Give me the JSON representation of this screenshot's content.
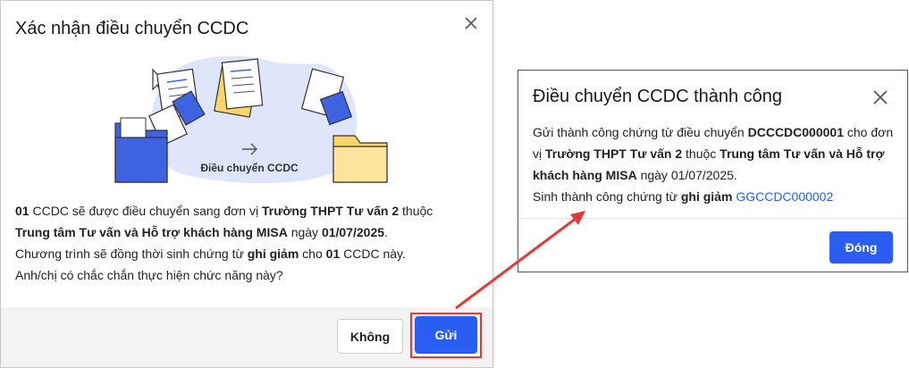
{
  "dialog_confirm": {
    "title": "Xác nhận điều chuyển CCDC",
    "illustration_caption": "Điều chuyển CCDC",
    "line1": {
      "count": "01",
      "t1": " CCDC sẽ được điều chuyển sang đơn vị ",
      "unit": "Trường THPT Tư vấn 2",
      "t2": " thuộc ",
      "parent": "Trung tâm Tư vấn và Hỗ trợ khách hàng MISA",
      "t3": " ngày ",
      "date": "01/07/2025",
      "t4": "."
    },
    "line2": {
      "t1": "Chương trình sẽ đồng thời sinh chứng từ ",
      "voucher_type": "ghi giảm",
      "t2": " cho ",
      "count": "01",
      "t3": " CCDC này."
    },
    "line3": "Anh/chị có chắc chắn thực hiện chức năng này?",
    "cancel_label": "Không",
    "send_label": "Gửi"
  },
  "dialog_success": {
    "title": "Điều chuyển CCDC thành công",
    "line1": {
      "t1": "Gửi thành công chứng từ điều chuyển ",
      "code": "DCCCDC000001",
      "t2": " cho đơn vị ",
      "unit": "Trường THPT Tư vấn 2",
      "t3": " thuộc ",
      "parent": "Trung tâm Tư vấn và Hỗ trợ khách hàng MISA",
      "t4": " ngày 01/07/2025."
    },
    "line2": {
      "t1": "Sinh thành công chứng từ ",
      "voucher_type": "ghi giảm",
      "t2": " ",
      "code": "GGCCDC000002"
    },
    "ok_label": "Đóng"
  },
  "colors": {
    "primary": "#2a5ef2",
    "highlight": "#e53935",
    "footer_bg": "#f3f3f3",
    "folder_blue": "#3d63e0",
    "folder_yellow": "#fcd56a"
  },
  "icons": [
    "close-icon",
    "cursor-icon",
    "arrow-right-icon",
    "folder-icon",
    "document-icon"
  ]
}
